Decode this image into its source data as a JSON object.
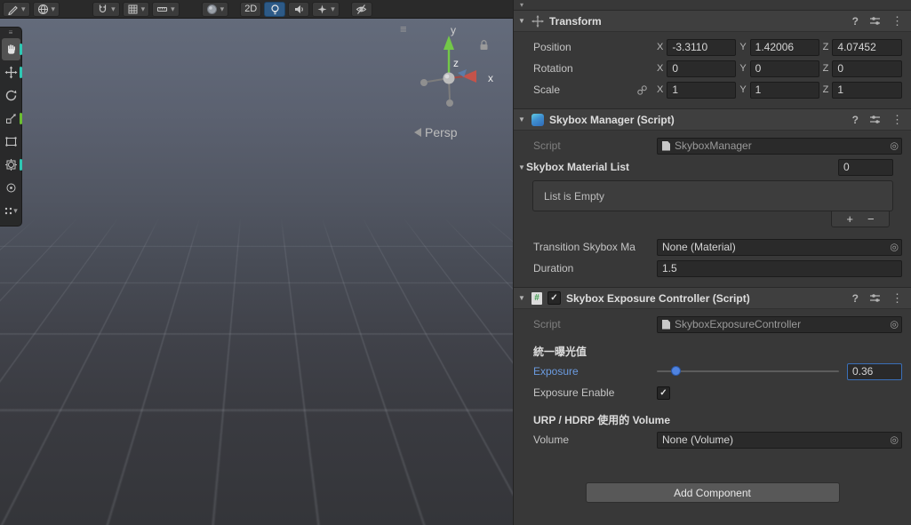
{
  "icons": {
    "caret_down": "▾",
    "foldout_open": "▼",
    "help": "?",
    "kebab": "⋮",
    "object_picker": "◎",
    "check": "✓",
    "plus": "+",
    "minus": "−",
    "menu": "≡",
    "handle_dots": "≡",
    "script_hash": "#"
  },
  "scene_toolbar": {
    "mode_2d_label": "2D"
  },
  "scene": {
    "gizmo": {
      "x_label": "x",
      "y_label": "y",
      "z_label": "z"
    },
    "projection_label": "Persp"
  },
  "inspector": {
    "axes": {
      "x": "X",
      "y": "Y",
      "z": "Z"
    },
    "transform": {
      "title": "Transform",
      "position_label": "Position",
      "rotation_label": "Rotation",
      "scale_label": "Scale",
      "position": {
        "x": "-3.3110",
        "y": "1.42006",
        "z": "4.07452"
      },
      "rotation": {
        "x": "0",
        "y": "0",
        "z": "0"
      },
      "scale": {
        "x": "1",
        "y": "1",
        "z": "1"
      }
    },
    "skybox_manager": {
      "title": "Skybox Manager (Script)",
      "script_label": "Script",
      "script_value": "SkyboxManager",
      "material_list_label": "Skybox Material List",
      "material_list_size": "0",
      "list_empty_text": "List is Empty",
      "transition_label": "Transition Skybox Ma",
      "transition_value": "None (Material)",
      "duration_label": "Duration",
      "duration_value": "1.5"
    },
    "exposure_controller": {
      "title": "Skybox Exposure Controller (Script)",
      "script_label": "Script",
      "script_value": "SkyboxExposureController",
      "exposure_section_label": "統一曝光值",
      "exposure_label": "Exposure",
      "exposure_value": "0.36",
      "exposure_enable_label": "Exposure Enable",
      "volume_section_label": "URP / HDRP 使用的 Volume",
      "volume_label": "Volume",
      "volume_value": "None (Volume)"
    },
    "add_component_label": "Add Component"
  }
}
